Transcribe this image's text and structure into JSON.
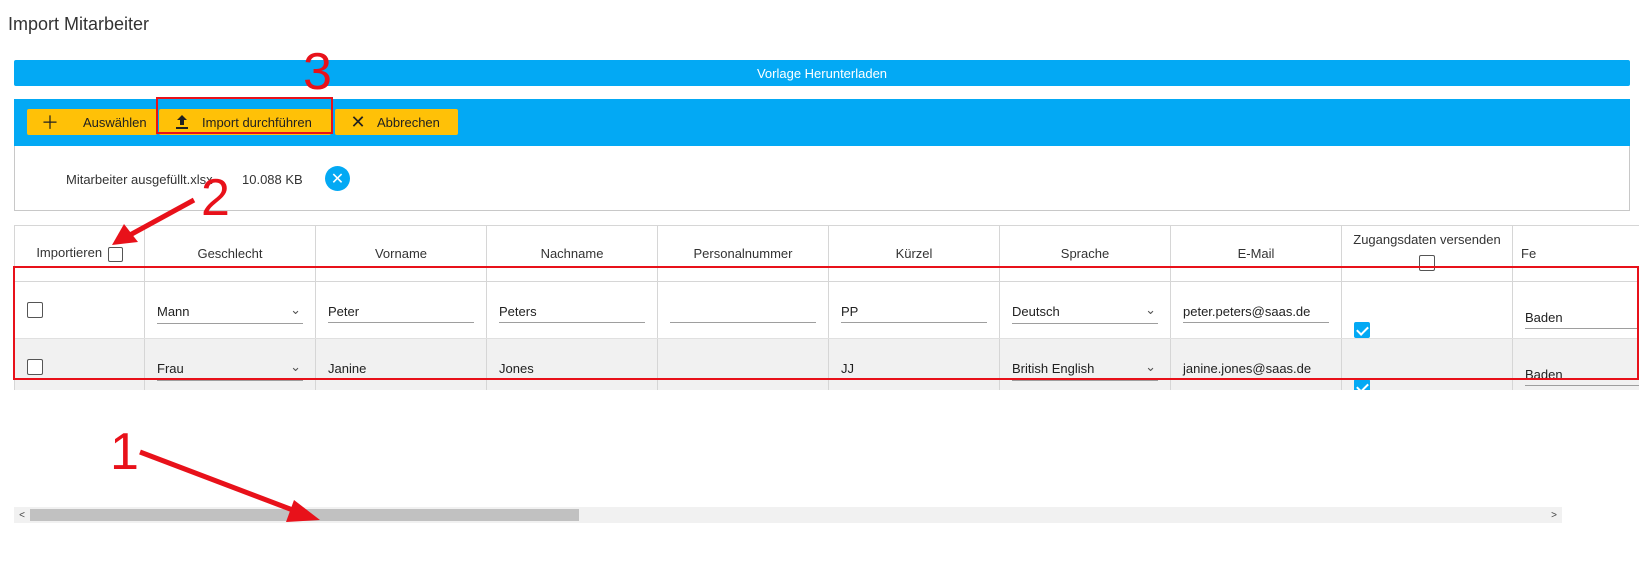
{
  "page": {
    "title": "Import Mitarbeiter"
  },
  "download_bar": {
    "label": "Vorlage Herunterladen"
  },
  "toolbar": {
    "select_label": "Auswählen",
    "import_label": "Import durchführen",
    "cancel_label": "Abbrechen"
  },
  "file": {
    "name": "Mitarbeiter ausgefüllt.xlsx",
    "size": "10.088 KB",
    "remove_icon": "close-icon"
  },
  "table": {
    "headers": {
      "import": "Importieren",
      "gender": "Geschlecht",
      "first_name": "Vorname",
      "last_name": "Nachname",
      "personnel_no": "Personalnummer",
      "abbreviation": "Kürzel",
      "language": "Sprache",
      "email": "E-Mail",
      "send_credentials": "Zugangsdaten versenden",
      "next_partial": "Fe"
    },
    "rows": [
      {
        "import": false,
        "gender": "Mann",
        "first_name": "Peter",
        "last_name": "Peters",
        "personnel_no": "",
        "abbreviation": "PP",
        "language": "Deutsch",
        "email": "peter.peters@saas.de",
        "send_credentials": true,
        "next_partial": "Baden"
      },
      {
        "import": false,
        "gender": "Frau",
        "first_name": "Janine",
        "last_name": "Jones",
        "personnel_no": "",
        "abbreviation": "JJ",
        "language": "British English",
        "email": "janine.jones@saas.de",
        "send_credentials": true,
        "next_partial": "Baden"
      }
    ]
  },
  "annotations": {
    "step_1": "1",
    "step_2": "2",
    "step_3": "3"
  },
  "colors": {
    "primary": "#03a9f4",
    "accent": "#ffc107",
    "annotation": "#e8111a"
  }
}
